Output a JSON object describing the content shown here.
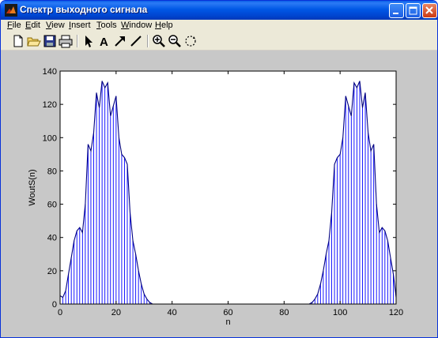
{
  "window": {
    "title": "Спектр выходного сигнала",
    "icon": "matlab-logo-icon",
    "controls": [
      "minimize",
      "maximize",
      "close"
    ]
  },
  "menu": [
    {
      "label": "File",
      "underline": "F",
      "rest": "ile"
    },
    {
      "label": "Edit",
      "underline": "E",
      "rest": "dit"
    },
    {
      "label": "View",
      "underline": "V",
      "rest": "iew"
    },
    {
      "label": "Insert",
      "underline": "I",
      "rest": "nsert"
    },
    {
      "label": "Tools",
      "underline": "T",
      "rest": "ools"
    },
    {
      "label": "Window",
      "underline": "W",
      "rest": "indow"
    },
    {
      "label": "Help",
      "underline": "H",
      "rest": "elp"
    }
  ],
  "toolbar": [
    "new-file-icon",
    "open-folder-icon",
    "save-icon",
    "print-icon",
    "select-arrow-icon",
    "insert-text-icon",
    "insert-arrow-icon",
    "insert-line-icon",
    "zoom-in-icon",
    "zoom-out-icon",
    "rotate-3d-icon"
  ],
  "chart_data": {
    "type": "line",
    "style": "stem plot with connecting line",
    "xlabel": "n",
    "ylabel": "WoutS(n)",
    "xlim": [
      0,
      120
    ],
    "ylim": [
      0,
      140
    ],
    "xticks": [
      0,
      20,
      40,
      60,
      80,
      100,
      120
    ],
    "yticks": [
      0,
      20,
      40,
      60,
      80,
      100,
      120,
      140
    ],
    "stem_color": "#0000ff",
    "line_color": "#000080",
    "x": [
      0,
      1,
      2,
      3,
      4,
      5,
      6,
      7,
      8,
      9,
      10,
      11,
      12,
      13,
      14,
      15,
      16,
      17,
      18,
      19,
      20,
      21,
      22,
      23,
      24,
      25,
      26,
      27,
      28,
      29,
      30,
      31,
      32,
      33,
      34,
      35,
      36,
      37,
      38,
      39,
      40,
      41,
      42,
      43,
      44,
      45,
      46,
      47,
      48,
      49,
      50,
      51,
      52,
      53,
      54,
      55,
      56,
      57,
      58,
      59,
      60,
      61,
      62,
      63,
      64,
      65,
      66,
      67,
      68,
      69,
      70,
      71,
      72,
      73,
      74,
      75,
      76,
      77,
      78,
      79,
      80,
      81,
      82,
      83,
      84,
      85,
      86,
      87,
      88,
      89,
      90,
      91,
      92,
      93,
      94,
      95,
      96,
      97,
      98,
      99,
      100,
      101,
      102,
      103,
      104,
      105,
      106,
      107,
      108,
      109,
      110,
      111,
      112,
      113,
      114,
      115,
      116,
      117,
      118,
      119,
      120
    ],
    "values": [
      5,
      4,
      8,
      18,
      28,
      38,
      44,
      46,
      43,
      60,
      96,
      92,
      103,
      127,
      118,
      134,
      130,
      133,
      113,
      119,
      125,
      100,
      90,
      88,
      84,
      55,
      38,
      30,
      20,
      12,
      6,
      3,
      1,
      0,
      0,
      0,
      0,
      0,
      0,
      0,
      0,
      0,
      0,
      0,
      0,
      0,
      0,
      0,
      0,
      0,
      0,
      0,
      0,
      0,
      0,
      0,
      0,
      0,
      0,
      0,
      0,
      0,
      0,
      0,
      0,
      0,
      0,
      0,
      0,
      0,
      0,
      0,
      0,
      0,
      0,
      0,
      0,
      0,
      0,
      0,
      0,
      0,
      0,
      0,
      0,
      0,
      0,
      0,
      0,
      0,
      1,
      3,
      6,
      12,
      20,
      30,
      38,
      55,
      84,
      88,
      90,
      100,
      125,
      119,
      113,
      133,
      130,
      134,
      118,
      127,
      103,
      92,
      96,
      60,
      43,
      46,
      44,
      38,
      28,
      18,
      4
    ]
  }
}
